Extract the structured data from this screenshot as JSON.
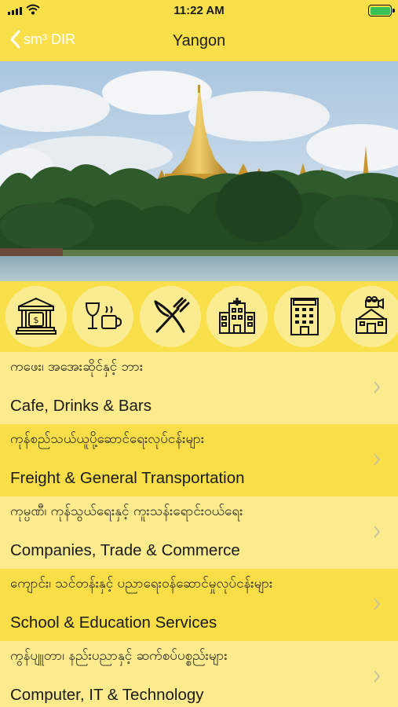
{
  "status_bar": {
    "time": "11:22 AM"
  },
  "nav": {
    "back_label": "sm³ DIR",
    "title": "Yangon"
  },
  "category_icons": [
    "bank-icon",
    "wine-coffee-icon",
    "fork-knife-icon",
    "hospital-icon",
    "hotel-icon",
    "cinema-icon"
  ],
  "categories": [
    {
      "mm": "ကဖေး၊ အအေးဆိုင်နှင့် ဘား",
      "en": "Cafe, Drinks & Bars"
    },
    {
      "mm": "ကုန်စည်သယ်ယူပို့ဆောင်ရေးလုပ်ငန်းများ",
      "en": "Freight & General Transportation"
    },
    {
      "mm": "ကုမ္ပဏီ၊ ကုန်သွယ်ရေးနှင့် ကူးသန်းရောင်းဝယ်ရေး",
      "en": "Companies, Trade & Commerce"
    },
    {
      "mm": "ကျောင်း၊ သင်တန်းနှင့် ပညာရေးဝန်ဆောင်မှုလုပ်ငန်းများ",
      "en": "School & Education Services"
    },
    {
      "mm": "ကွန်ပျူတာ၊ နည်းပညာနှင့် ဆက်စပ်ပစ္စည်းများ",
      "en": "Computer, IT & Technology"
    }
  ],
  "colors": {
    "accent": "#f9e04b",
    "row_light": "#fbeb8d",
    "row_dark": "#f9de48",
    "icon_circle": "#fbec92"
  }
}
